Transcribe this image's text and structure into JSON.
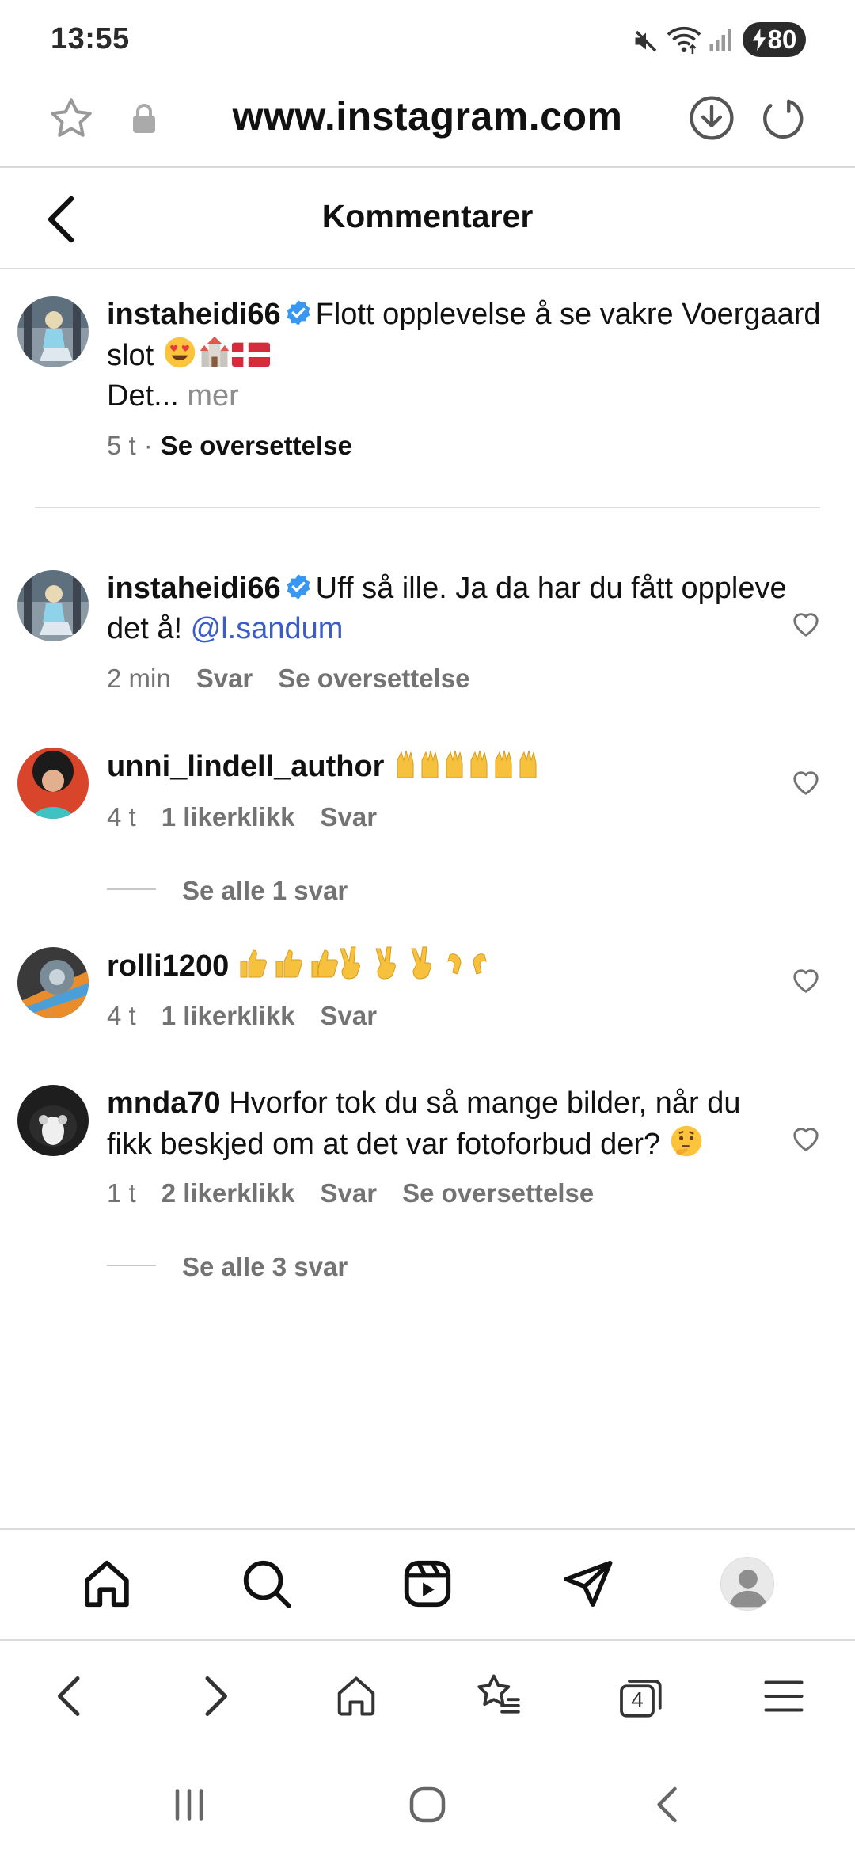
{
  "status_bar": {
    "time": "13:55",
    "battery": "80",
    "icons": [
      "mute-icon",
      "wifi-icon",
      "signal-icon",
      "charging-icon"
    ]
  },
  "browser": {
    "url": "www.instagram.com",
    "icons": [
      "bookmark-star-icon",
      "lock-icon",
      "download-icon",
      "reload-icon"
    ]
  },
  "header": {
    "title": "Kommentarer"
  },
  "caption": {
    "username": "instaheidi66",
    "text": "Flott opplevelse å se vakre Voergaard slot",
    "text_more": "Det...",
    "more_label": "mer",
    "time": "5 t",
    "translate_label": "Se oversettelse"
  },
  "comments": [
    {
      "username": "instaheidi66",
      "text": "Uff så ille. Ja da har du fått oppleve det å!",
      "mention": "@l.sandum",
      "time": "2 min",
      "reply_label": "Svar",
      "translate_label": "Se oversettelse"
    },
    {
      "username": "unni_lindell_author",
      "time": "4 t",
      "likes": "1 likerklikk",
      "reply_label": "Svar",
      "view_replies": "Se alle 1 svar"
    },
    {
      "username": "rolli1200",
      "time": "4 t",
      "likes": "1 likerklikk",
      "reply_label": "Svar"
    },
    {
      "username": "mnda70",
      "text": "Hvorfor tok du så mange bilder, når du fikk beskjed om at det var fotoforbud der?",
      "time": "1 t",
      "likes": "2 likerklikk",
      "reply_label": "Svar",
      "translate_label": "Se oversettelse",
      "view_replies": "Se alle 3 svar"
    }
  ],
  "bottom_nav": {
    "items": [
      "home-icon",
      "search-icon",
      "reels-icon",
      "direct-icon",
      "profile-icon"
    ]
  },
  "browser_nav": {
    "tab_count": "4",
    "items": [
      "back-icon",
      "forward-icon",
      "home-icon",
      "bookmarks-icon",
      "tabs-icon",
      "menu-icon"
    ]
  },
  "colors": {
    "mention": "#3b5cc9",
    "verified": "#3897f0",
    "secondary_text": "#737373"
  }
}
